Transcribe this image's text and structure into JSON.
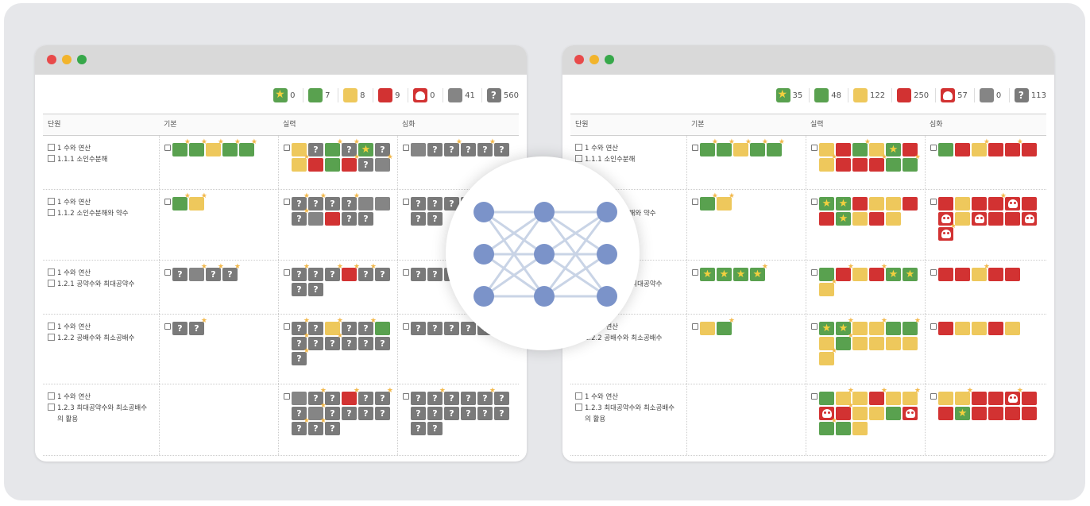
{
  "windows": [
    {
      "legend": [
        {
          "icon": "star-icon",
          "color": "#59a14f",
          "count": "0"
        },
        {
          "icon": "green-square",
          "color": "#59a14f",
          "count": "7"
        },
        {
          "icon": "yellow-square",
          "color": "#eec85c",
          "count": "8"
        },
        {
          "icon": "red-square",
          "color": "#d23232",
          "count": "9"
        },
        {
          "icon": "skull-icon",
          "color": "#d23232",
          "count": "0"
        },
        {
          "icon": "gray-square",
          "color": "#858585",
          "count": "41"
        },
        {
          "icon": "question-icon",
          "color": "#7a7a7a",
          "count": "560"
        }
      ],
      "headers": [
        "단원",
        "기본",
        "실력",
        "심화"
      ],
      "rows": [
        {
          "unit_line1": "1 수와 연산",
          "unit_line2": "1.1.1 소인수분해",
          "unit_line3": "",
          "cells": [
            [
              "g*",
              "g*",
              "y*",
              "g*",
              "g*"
            ],
            [
              "y",
              "q",
              "g*",
              "q*",
              "gS",
              "q",
              "y*",
              "r",
              "g",
              "r*",
              "q",
              "gr*"
            ],
            [
              "gr",
              "q",
              "q*",
              "q",
              "q*",
              "q"
            ]
          ]
        },
        {
          "unit_line1": "1 수와 연산",
          "unit_line2": "1.1.2 소인수분해와 약수",
          "unit_line3": "",
          "cells": [
            [
              "g*",
              "y*"
            ],
            [
              "q*",
              "q*",
              "q",
              "q*",
              "gr",
              "gr",
              "q*",
              "gr",
              "r",
              "q",
              "q"
            ],
            [
              "q",
              "q",
              "q",
              "q",
              "q",
              "q",
              "q",
              "q"
            ]
          ]
        },
        {
          "unit_line1": "1 수와 연산",
          "unit_line2": "1.2.1 공약수와 최대공약수",
          "unit_line3": "",
          "cells": [
            [
              "q",
              "gr*",
              "q*",
              "q*"
            ],
            [
              "q*",
              "q",
              "q*",
              "r*",
              "q*",
              "q",
              "q",
              "q"
            ],
            [
              "q",
              "q",
              "q",
              "q",
              "q",
              "q"
            ]
          ]
        },
        {
          "unit_line1": "1 수와 연산",
          "unit_line2": "1.2.2 공배수와 최소공배수",
          "unit_line3": "",
          "cells": [
            [
              "q",
              "q*"
            ],
            [
              "q*",
              "q",
              "y*",
              "q",
              "q*",
              "g",
              "q*",
              "q",
              "q*",
              "q",
              "q",
              "q",
              "q*"
            ],
            [
              "q",
              "q",
              "q",
              "q",
              "q",
              "q"
            ]
          ]
        },
        {
          "unit_line1": "1 수와 연산",
          "unit_line2": "1.2.3 최대공약수와 최소공배수",
          "unit_line3": "의 활용",
          "cells": [
            [],
            [
              "gr",
              "q*",
              "q",
              "r*",
              "q",
              "q*",
              "q",
              "gr*",
              "q",
              "q",
              "q",
              "q",
              "q*",
              "q*",
              "q"
            ],
            [
              "q",
              "q*",
              "q",
              "q",
              "q*",
              "q",
              "q",
              "q",
              "q",
              "q",
              "q",
              "q",
              "q",
              "q"
            ]
          ]
        }
      ]
    },
    {
      "legend": [
        {
          "icon": "star-icon",
          "color": "#59a14f",
          "count": "35"
        },
        {
          "icon": "green-square",
          "color": "#59a14f",
          "count": "48"
        },
        {
          "icon": "yellow-square",
          "color": "#eec85c",
          "count": "122"
        },
        {
          "icon": "red-square",
          "color": "#d23232",
          "count": "250"
        },
        {
          "icon": "skull-icon",
          "color": "#d23232",
          "count": "57"
        },
        {
          "icon": "gray-square",
          "color": "#858585",
          "count": "0"
        },
        {
          "icon": "question-icon",
          "color": "#7a7a7a",
          "count": "113"
        }
      ],
      "headers": [
        "단원",
        "기본",
        "실력",
        "심화"
      ],
      "rows": [
        {
          "unit_line1": "1 수와 연산",
          "unit_line2": "1.1.1 소인수분해",
          "unit_line3": "",
          "cells": [
            [
              "g*",
              "g*",
              "y*",
              "g*",
              "g*"
            ],
            [
              "y",
              "r",
              "g*",
              "y",
              "gS",
              "r",
              "y*",
              "r",
              "r",
              "r*",
              "g",
              "g*"
            ],
            [
              "g",
              "r",
              "y*",
              "r",
              "r*",
              "r"
            ]
          ]
        },
        {
          "unit_line1": "1 수와 연산",
          "unit_line2": "1.1.2 소인수분해와 약수",
          "unit_line3": "",
          "cells": [
            [
              "g*",
              "y*"
            ],
            [
              "gS",
              "gS",
              "r",
              "y",
              "y",
              "r",
              "r",
              "gS",
              "y",
              "r",
              "y"
            ],
            [
              "r",
              "y",
              "r",
              "r*",
              "rK",
              "r",
              "rK",
              "y",
              "rK",
              "r",
              "r",
              "rK",
              "rK*"
            ]
          ]
        },
        {
          "unit_line1": "1 수와 연산",
          "unit_line2": "1.2.1 공약수와 최대공약수",
          "unit_line3": "",
          "cells": [
            [
              "gS",
              "gS",
              "gS",
              "gS*"
            ],
            [
              "g",
              "r*",
              "y",
              "r*",
              "gS",
              "gS",
              "y*"
            ],
            [
              "r",
              "r",
              "y*",
              "r",
              "r"
            ]
          ]
        },
        {
          "unit_line1": "1 수와 연산",
          "unit_line2": "1.2.2 공배수와 최소공배수",
          "unit_line3": "",
          "cells": [
            [
              "y",
              "g*"
            ],
            [
              "gS",
              "gS*",
              "y",
              "y*",
              "g",
              "g*",
              "y",
              "g*",
              "y",
              "y",
              "y",
              "y",
              "y*"
            ],
            [
              "r",
              "y",
              "y",
              "r",
              "y"
            ]
          ]
        },
        {
          "unit_line1": "1 수와 연산",
          "unit_line2": "1.2.3 최대공약수와 최소공배수",
          "unit_line3": "의 활용",
          "cells": [
            [],
            [
              "g",
              "y*",
              "y",
              "r*",
              "y",
              "y*",
              "rK",
              "r*",
              "y",
              "y",
              "g",
              "rK",
              "g*",
              "g",
              "y"
            ],
            [
              "y",
              "y*",
              "r",
              "r",
              "rK*",
              "r",
              "r",
              "gS",
              "r",
              "r",
              "r",
              "r"
            ]
          ]
        }
      ]
    }
  ],
  "network": {
    "node_color": "#7b93c9",
    "edge_color": "#c9d4e6"
  }
}
